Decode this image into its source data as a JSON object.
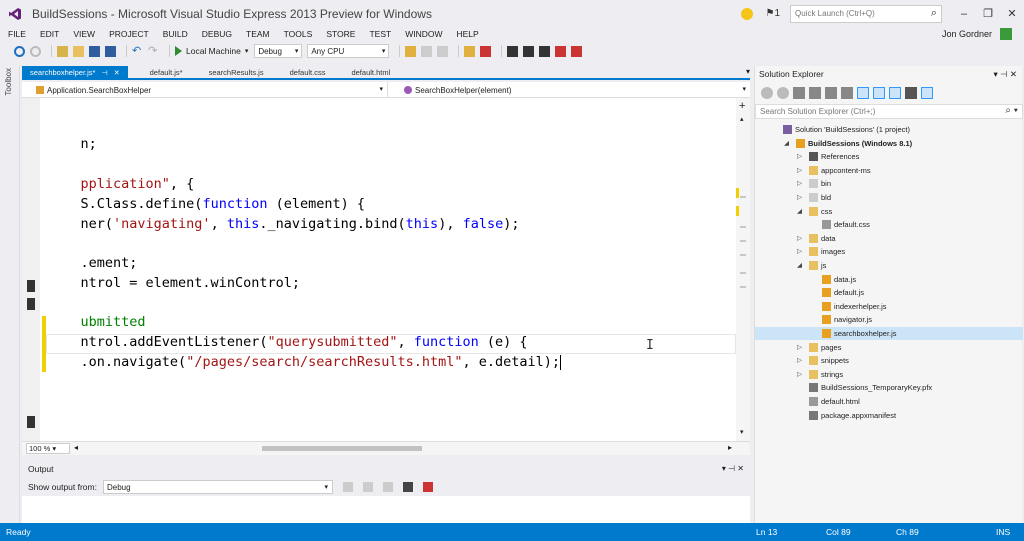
{
  "window": {
    "title": "BuildSessions - Microsoft Visual Studio Express 2013 Preview for Windows",
    "quick_launch_placeholder": "Quick Launch (Ctrl+Q)",
    "user": "Jon Gordner",
    "notifications": "1"
  },
  "menu": [
    "FILE",
    "EDIT",
    "VIEW",
    "PROJECT",
    "BUILD",
    "DEBUG",
    "TEAM",
    "TOOLS",
    "STORE",
    "TEST",
    "WINDOW",
    "HELP"
  ],
  "toolbar": {
    "run_target": "Local Machine",
    "configuration": "Debug",
    "platform": "Any CPU"
  },
  "toolbox_label": "Toolbox",
  "tabs": [
    {
      "label": "searchboxhelper.js*",
      "active": true
    },
    {
      "label": "default.js*",
      "active": false
    },
    {
      "label": "searchResults.js",
      "active": false
    },
    {
      "label": "default.css",
      "active": false
    },
    {
      "label": "default.html",
      "active": false
    }
  ],
  "navbar": {
    "left": "Application.SearchBoxHelper",
    "right": "SearchBoxHelper(element)"
  },
  "code_lines": [
    [
      {
        "t": "n;",
        "c": "p"
      }
    ],
    [],
    [
      {
        "t": "pplication",
        "c": "s"
      },
      {
        "t": "\", {",
        "c": "p"
      }
    ],
    [
      {
        "t": "S.Class.define(",
        "c": "p"
      },
      {
        "t": "function",
        "c": "k"
      },
      {
        "t": " (element) {",
        "c": "p"
      }
    ]
  ],
  "code": {
    "l1": "n;",
    "l3a": "pplication\"",
    "l3b": ", {",
    "l4a": "S.Class.define(",
    "l4b": "function",
    "l4c": " (element) {",
    "l5a": "ner(",
    "l5b": "'navigating'",
    "l5c": ", ",
    "l5d": "this",
    "l5e": "._navigating.bind(",
    "l5f": "this",
    "l5g": "), ",
    "l5h": "false",
    "l5i": ");",
    "l7": ".ement;",
    "l8": "ntrol = element.winControl;",
    "l10": "ubmitted",
    "l11a": "ntrol.addEventListener(",
    "l11b": "\"querysubmitted\"",
    "l11c": ", ",
    "l11d": "function",
    "l11e": " (e) {",
    "l12a": ".on.navigate(",
    "l12b": "\"/pages/search/searchResults.html\"",
    "l12c": ", e.detail);"
  },
  "zoom": "100 %",
  "output": {
    "title": "Output",
    "show_from_label": "Show output from:",
    "show_from_value": "Debug"
  },
  "solution_explorer": {
    "title": "Solution Explorer",
    "search_placeholder": "Search Solution Explorer (Ctrl+;)",
    "items": [
      {
        "label": "Solution 'BuildSessions' (1 project)",
        "level": 0,
        "expand": "",
        "icon": "solution"
      },
      {
        "label": "BuildSessions (Windows 8.1)",
        "level": 1,
        "expand": "open",
        "icon": "js-project",
        "bold": true
      },
      {
        "label": "References",
        "level": 2,
        "expand": "closed",
        "icon": "references"
      },
      {
        "label": "appcontent-ms",
        "level": 2,
        "expand": "closed",
        "icon": "folder"
      },
      {
        "label": "bin",
        "level": 2,
        "expand": "closed",
        "icon": "folder-outline"
      },
      {
        "label": "bld",
        "level": 2,
        "expand": "closed",
        "icon": "folder-outline"
      },
      {
        "label": "css",
        "level": 2,
        "expand": "open",
        "icon": "folder"
      },
      {
        "label": "default.css",
        "level": 3,
        "expand": "",
        "icon": "file"
      },
      {
        "label": "data",
        "level": 2,
        "expand": "closed",
        "icon": "folder"
      },
      {
        "label": "images",
        "level": 2,
        "expand": "closed",
        "icon": "folder"
      },
      {
        "label": "js",
        "level": 2,
        "expand": "open",
        "icon": "folder"
      },
      {
        "label": "data.js",
        "level": 3,
        "expand": "",
        "icon": "js-file"
      },
      {
        "label": "default.js",
        "level": 3,
        "expand": "",
        "icon": "js-file"
      },
      {
        "label": "indexerhelper.js",
        "level": 3,
        "expand": "",
        "icon": "js-file"
      },
      {
        "label": "navigator.js",
        "level": 3,
        "expand": "",
        "icon": "js-file"
      },
      {
        "label": "searchboxhelper.js",
        "level": 3,
        "expand": "",
        "icon": "js-file",
        "selected": true
      },
      {
        "label": "pages",
        "level": 2,
        "expand": "closed",
        "icon": "folder"
      },
      {
        "label": "snippets",
        "level": 2,
        "expand": "closed",
        "icon": "folder"
      },
      {
        "label": "strings",
        "level": 2,
        "expand": "closed",
        "icon": "folder"
      },
      {
        "label": "BuildSessions_TemporaryKey.pfx",
        "level": 2,
        "expand": "",
        "icon": "key-file"
      },
      {
        "label": "default.html",
        "level": 2,
        "expand": "",
        "icon": "file"
      },
      {
        "label": "package.appxmanifest",
        "level": 2,
        "expand": "",
        "icon": "manifest"
      }
    ]
  },
  "status": {
    "ready": "Ready",
    "ln": "Ln 13",
    "col": "Col 89",
    "ch": "Ch 89",
    "ins": "INS"
  },
  "colors": {
    "accent": "#007acc",
    "keyword": "#0000ff",
    "string": "#a31515",
    "comment": "#008000",
    "change_bar": "#f0d000"
  }
}
